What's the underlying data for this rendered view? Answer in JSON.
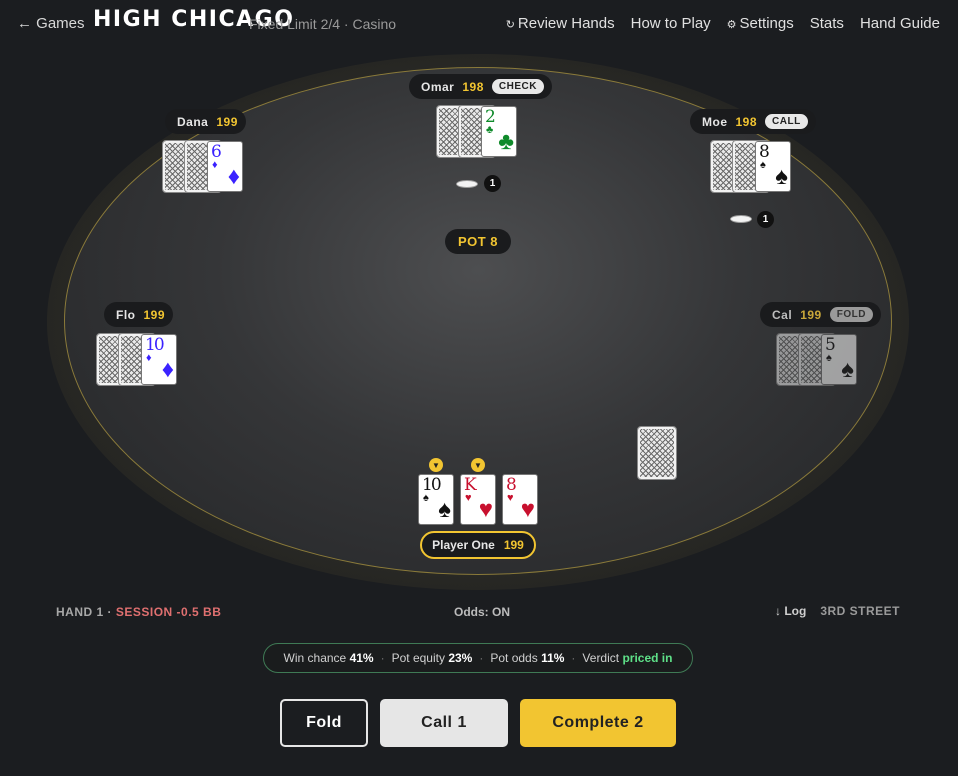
{
  "nav": {
    "back_label": "← Games",
    "brand": "HIGH CHICAGO",
    "subtitle": "Fixed Limit 2/4 · Casino",
    "links": {
      "review_icon": "↻",
      "review": "Review Hands",
      "howto": "How to Play",
      "settings_icon": "⚙",
      "settings": "Settings",
      "stats": "Stats",
      "guide": "Hand Guide"
    }
  },
  "seats": {
    "omar": {
      "name": "Omar",
      "stack": "198",
      "badge": "CHECK",
      "bet": "1",
      "upcard": {
        "rank": "2",
        "suit": "♣",
        "color": "grn"
      }
    },
    "dana": {
      "name": "Dana",
      "stack": "199",
      "upcard": {
        "rank": "6",
        "suit": "♦",
        "color": "blu"
      }
    },
    "moe": {
      "name": "Moe",
      "stack": "198",
      "badge": "CALL",
      "bet": "1",
      "upcard": {
        "rank": "8",
        "suit": "♠",
        "color": "blk"
      }
    },
    "flo": {
      "name": "Flo",
      "stack": "199",
      "upcard": {
        "rank": "10",
        "suit": "♦",
        "color": "blu"
      }
    },
    "cal": {
      "name": "Cal",
      "stack": "199",
      "badge": "FOLD",
      "upcard": {
        "rank": "5",
        "suit": "♠",
        "color": "blk"
      }
    }
  },
  "pot": "POT 8",
  "hero": {
    "name": "Player One",
    "stack": "199",
    "cards": [
      {
        "rank": "10",
        "suit": "♠",
        "color": "blk",
        "hole": true
      },
      {
        "rank": "K",
        "suit": "♥",
        "color": "red",
        "hole": true
      },
      {
        "rank": "8",
        "suit": "♥",
        "color": "red",
        "hole": false
      }
    ],
    "hole_marker_icon": "▼"
  },
  "status": {
    "hand": "HAND 1 · ",
    "session": "SESSION -0.5 BB",
    "odds_toggle": "Odds: ON",
    "log_icon": "↓",
    "log": "Log",
    "street": "3RD STREET"
  },
  "odds": {
    "win_label": "Win chance",
    "win_value": "41%",
    "equity_label": "Pot equity",
    "equity_value": "23%",
    "potodds_label": "Pot odds",
    "potodds_value": "11%",
    "verdict_label": "Verdict",
    "verdict_value": "priced in",
    "sep": "·"
  },
  "actions": {
    "fold": "Fold",
    "call": "Call 1",
    "raise": "Complete 2"
  },
  "colors": {
    "accent": "#f2c531",
    "felt": "#3a3b3d",
    "verdict": "#5ee088"
  }
}
